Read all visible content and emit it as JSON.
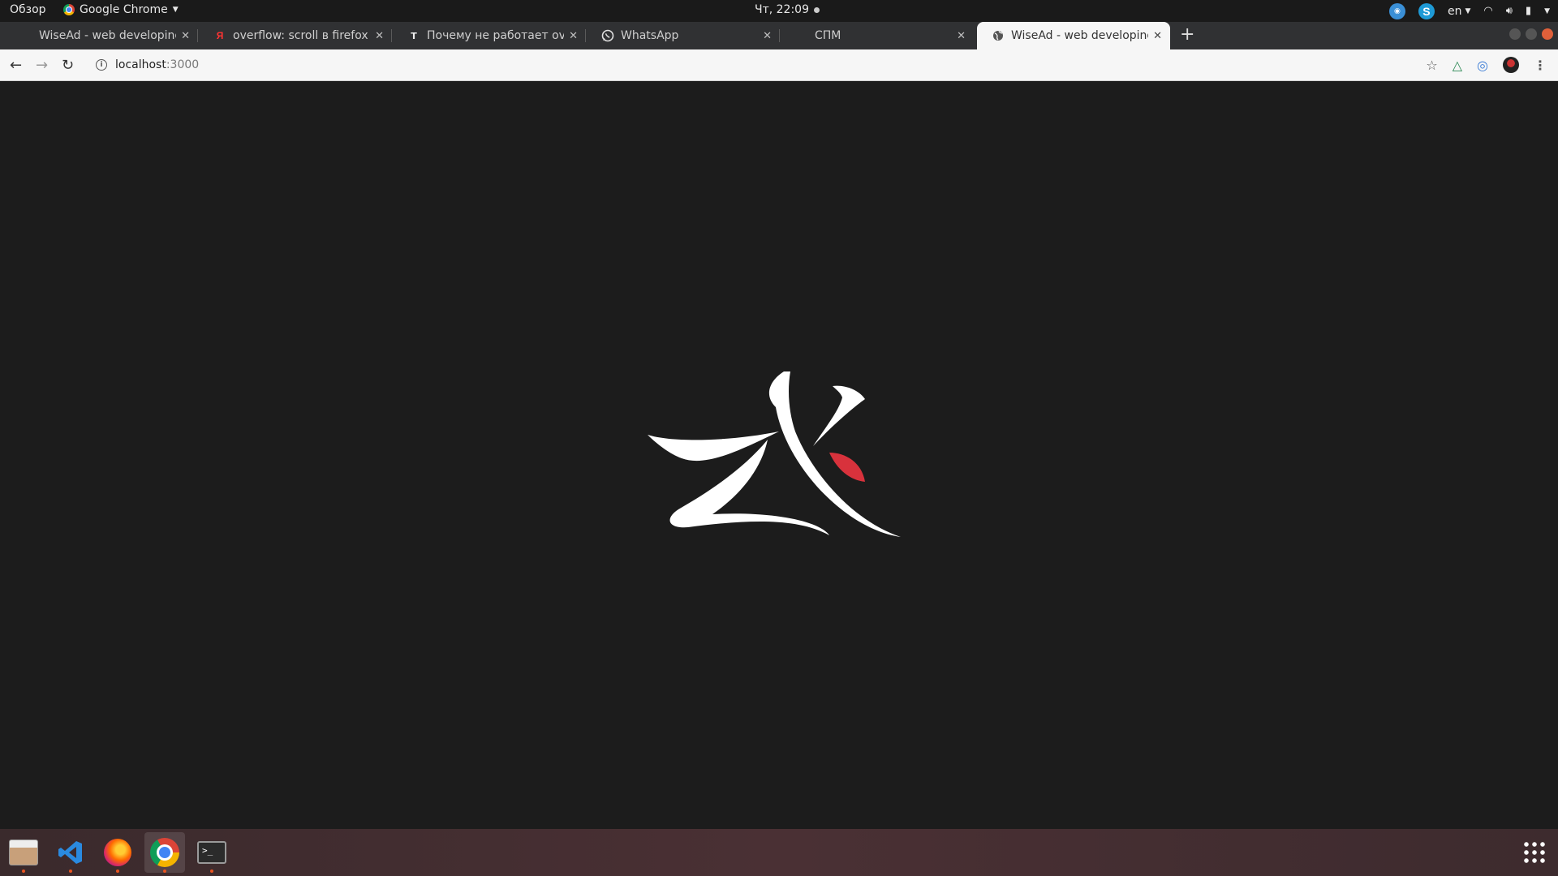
{
  "topbar": {
    "overview_label": "Обзор",
    "app_name": "Google Chrome",
    "clock": "Чт, 22:09",
    "language": "en"
  },
  "tabs": [
    {
      "title": "WiseAd - web developing",
      "favicon": "wisead-favicon",
      "active": false
    },
    {
      "title": "overflow: scroll в firefox",
      "favicon": "yandex-icon",
      "active": false
    },
    {
      "title": "Почему не работает overflow",
      "favicon": "toster-icon",
      "active": false
    },
    {
      "title": "WhatsApp",
      "favicon": "whatsapp-icon",
      "active": false
    },
    {
      "title": "СПМ",
      "favicon": "blank-favicon",
      "active": false
    },
    {
      "title": "WiseAd - web developing",
      "favicon": "globe-icon",
      "active": true
    }
  ],
  "omnibox": {
    "host": "localhost",
    "port": ":3000"
  },
  "colors": {
    "page_background": "#1c1c1c",
    "logo_white": "#ffffff",
    "logo_accent": "#d8323c"
  },
  "dock": {
    "items": [
      "files-icon",
      "vscode-icon",
      "firefox-icon",
      "chrome-icon",
      "terminal-icon"
    ]
  }
}
